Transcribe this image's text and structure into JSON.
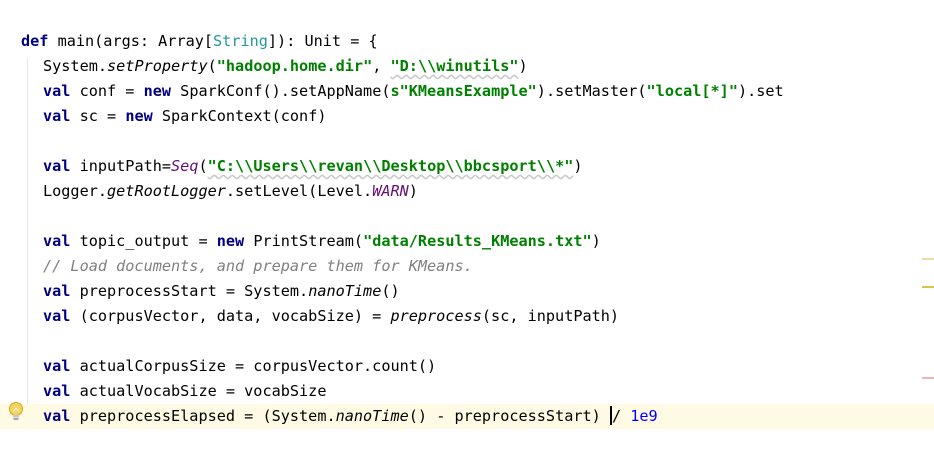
{
  "editor": {
    "lines": {
      "l1": {
        "kw_def": "def",
        "t1": " main(args: Array[",
        "type_string": "String",
        "t2": "]): Unit = {"
      },
      "l2": {
        "t1": "System.",
        "m_setProperty": "setProperty",
        "t2": "(",
        "s1": "\"hadoop.home.dir\"",
        "t3": ", ",
        "s2": "\"D:\\\\winutils\"",
        "t4": ")"
      },
      "l3": {
        "kw_val": "val",
        "t1": " conf = ",
        "kw_new": "new",
        "t2": " SparkConf().setAppName(",
        "s1": "s\"KMeansExample\"",
        "t3": ").setMaster(",
        "s2": "\"local[*]\"",
        "t4": ").set"
      },
      "l4": {
        "kw_val": "val",
        "t1": " sc = ",
        "kw_new": "new",
        "t2": " SparkContext(conf)"
      },
      "l5": {
        "kw_val": "val",
        "t1": " inputPath=",
        "m_seq": "Seq",
        "t2": "(",
        "s1": "\"C:\\\\Users\\\\revan\\\\Desktop\\\\bbcsport\\\\*\"",
        "t3": ")"
      },
      "l6": {
        "t1": "Logger.",
        "m_getRootLogger": "getRootLogger",
        "t2": ".setLevel(Level.",
        "f_warn": "WARN",
        "t3": ")"
      },
      "l7": {
        "kw_val": "val",
        "t1": " topic_output = ",
        "kw_new": "new",
        "t2": " PrintStream(",
        "s1": "\"data/Results_KMeans.txt\"",
        "t3": ")"
      },
      "l8": {
        "comment": "// Load documents, and prepare them for KMeans."
      },
      "l9": {
        "kw_val": "val",
        "t1": " preprocessStart = System.",
        "m_nanoTime": "nanoTime",
        "t2": "()"
      },
      "l10": {
        "kw_val": "val",
        "t1": " (corpusVector, data, vocabSize) = ",
        "m_preprocess": "preprocess",
        "t2": "(sc, inputPath)"
      },
      "l11": {
        "kw_val": "val",
        "t1": " actualCorpusSize = corpusVector.count()"
      },
      "l12": {
        "kw_val": "val",
        "t1": " actualVocabSize = vocabSize"
      },
      "l13": {
        "kw_val": "val",
        "t1": " preprocessElapsed = (System.",
        "m_nanoTime": "nanoTime",
        "t2": "() - preprocessStart) ",
        "t3": "/ ",
        "num": "1e9"
      }
    }
  },
  "colors": {
    "keyword": "#000080",
    "string": "#008000",
    "type": "#20999d",
    "static_field": "#660e7a",
    "comment": "#808080",
    "number": "#0000ff",
    "current_line": "#fffae3",
    "warning_marker": "#d6c64a",
    "error_marker": "#f0b4b4"
  },
  "icons": {
    "intention": "lightbulb-icon"
  }
}
